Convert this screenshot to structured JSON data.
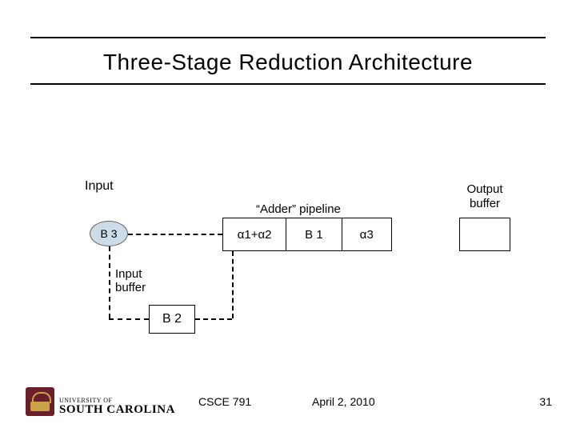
{
  "title": "Three-Stage Reduction Architecture",
  "labels": {
    "input": "Input",
    "b3": "B 3",
    "adder_pipeline": "“Adder” pipeline",
    "output_buffer_line1": "Output",
    "output_buffer_line2": "buffer",
    "input_buffer_line1": "Input",
    "input_buffer_line2": "buffer",
    "b2": "B 2"
  },
  "pipeline": {
    "cells": [
      "α1+α2",
      "B 1",
      "α3"
    ]
  },
  "footer": {
    "university_line1": "UNIVERSITY OF",
    "university_line2": "SOUTH CAROLINA",
    "course": "CSCE 791",
    "date": "April 2, 2010",
    "page": "31"
  }
}
